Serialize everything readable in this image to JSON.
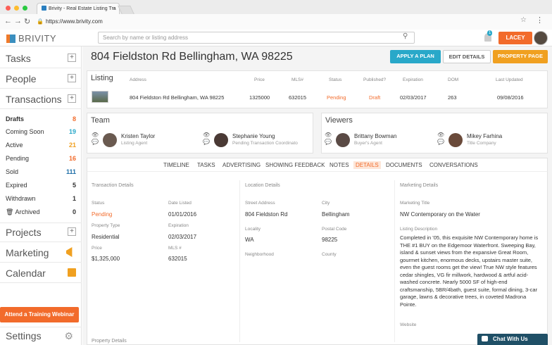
{
  "browser": {
    "tab_title": "Brivity - Real Estate Listing Tra",
    "url": "https://www.brivity.com"
  },
  "header": {
    "logo_text": "BRIVITY",
    "search_placeholder": "Search by name or listing address",
    "notifications_count": "1",
    "user_name": "LACEY"
  },
  "sidebar": {
    "tasks": "Tasks",
    "people": "People",
    "transactions": "Transactions",
    "items": [
      {
        "label": "Drafts",
        "count": "8",
        "color": "#f26b2b"
      },
      {
        "label": "Coming Soon",
        "count": "19",
        "color": "#29a8c9"
      },
      {
        "label": "Active",
        "count": "21",
        "color": "#f0a020"
      },
      {
        "label": "Pending",
        "count": "16",
        "color": "#f26b2b"
      },
      {
        "label": "Sold",
        "count": "111",
        "color": "#1f6fa8"
      },
      {
        "label": "Expired",
        "count": "5",
        "color": "#333333"
      },
      {
        "label": "Withdrawn",
        "count": "1",
        "color": "#333333"
      },
      {
        "label": "Archived",
        "count": "0",
        "color": "#333333"
      }
    ],
    "projects": "Projects",
    "marketing": "Marketing",
    "calendar": "Calendar",
    "training": "Attend a Training Webinar",
    "settings": "Settings"
  },
  "main": {
    "title": "804 Fieldston Rd Bellingham, WA 98225",
    "apply_plan": "APPLY A PLAN",
    "edit_details": "EDIT DETAILS",
    "property_page": "PROPERTY PAGE"
  },
  "listing": {
    "section": "Listing",
    "headers": {
      "address": "Address",
      "price": "Price",
      "mls": "MLS#",
      "status": "Status",
      "published": "Published?",
      "expiration": "Expiration",
      "dom": "DOM",
      "last_updated": "Last Updated"
    },
    "row": {
      "address": "804 Fieldston Rd Bellingham, WA 98225",
      "price": "1325000",
      "mls": "632015",
      "status": "Pending",
      "published": "Draft",
      "expiration": "02/03/2017",
      "dom": "263",
      "last_updated": "09/08/2016"
    }
  },
  "team": {
    "title": "Team",
    "members": [
      {
        "name": "Kristen Taylor",
        "role": "Listing Agent"
      },
      {
        "name": "Stephanie Young",
        "role": "Pending Transaction Coordinato"
      }
    ]
  },
  "viewers": {
    "title": "Viewers",
    "members": [
      {
        "name": "Brittany Bowman",
        "role": "Buyer's Agent"
      },
      {
        "name": "Mikey Farhina",
        "role": "Title Company"
      }
    ]
  },
  "tabs": [
    "TIMELINE",
    "TASKS",
    "ADVERTISING",
    "SHOWING FEEDBACK",
    "NOTES",
    "DETAILS",
    "DOCUMENTS",
    "CONVERSATIONS"
  ],
  "transaction_details": {
    "title": "Transaction Details",
    "status_label": "Status",
    "status": "Pending",
    "date_listed_label": "Date Listed",
    "date_listed": "01/01/2016",
    "property_type_label": "Property Type",
    "property_type": "Residential",
    "expiration_label": "Expiration",
    "expiration": "02/03/2017",
    "price_label": "Price",
    "price": "$1,325,000",
    "mls_label": "MLS #",
    "mls": "632015",
    "property_details": "Property Details"
  },
  "location_details": {
    "title": "Location Details",
    "street_label": "Street Address",
    "street": "804 Fieldston Rd",
    "city_label": "City",
    "city": "Bellingham",
    "locality_label": "Locality",
    "locality": "WA",
    "postal_label": "Postal Code",
    "postal": "98225",
    "neighborhood_label": "Neighborhood",
    "county_label": "County"
  },
  "marketing_details": {
    "title": "Marketing Details",
    "mtitle_label": "Marketing Title",
    "mtitle": "NW Contemporary on the Water",
    "desc_label": "Listing Description",
    "description": "Completed in '05, this exquisite NW Contemporary home is THE #1 BUY on the Edgemoor Waterfront. Sweeping Bay, island & sunset views from the expansive Great Room, gourmet kitchen, enormous decks, upstairs master suite, even the guest rooms get the view! True NW style features cedar shingles, VG fir millwork, hardwood & artful acid-washed concrete. Nearly 5000 SF of high-end craftsmanship, 5BR/4bath, guest suite, formal dining, 3-car garage, lawns & decorative trees, in coveted Madrona Pointe.",
    "website_label": "Website"
  },
  "chat": "Chat With Us"
}
